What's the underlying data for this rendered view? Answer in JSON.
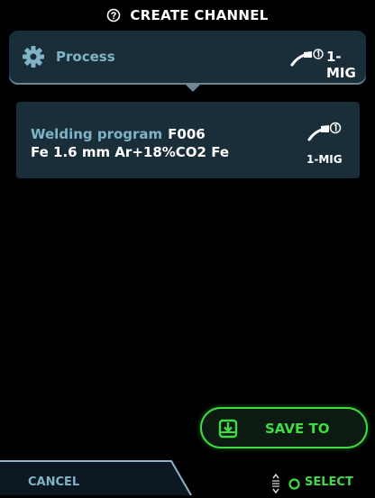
{
  "header": {
    "title": "CREATE CHANNEL",
    "help_icon": "question-circle-icon"
  },
  "process": {
    "label": "Process",
    "icon": "gear-icon",
    "mode_icon": "welding-torch-icon",
    "mode": "1-MIG"
  },
  "program": {
    "label": "Welding program",
    "code": "F006",
    "description": "Fe 1.6 mm Ar+18%CO2 Fe",
    "mode_icon": "welding-torch-icon",
    "mode": "1-MIG"
  },
  "actions": {
    "save_label": "SAVE TO",
    "save_icon": "save-download-icon",
    "cancel_label": "CANCEL",
    "select_label": "SELECT",
    "scroll_icon": "scroll-wheel-icon"
  },
  "colors": {
    "background": "#000000",
    "panel": "#1a2e3a",
    "label_blue": "#7fb3c8",
    "accent_green": "#3ddc42"
  }
}
